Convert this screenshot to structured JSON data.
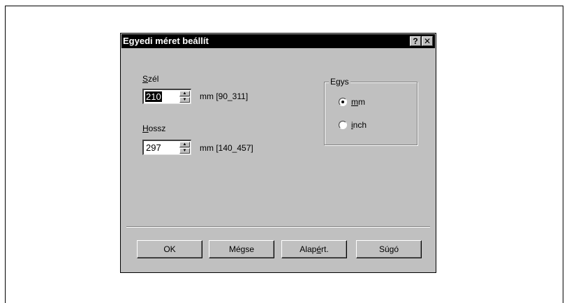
{
  "window": {
    "title": "Egyedi méret beállít",
    "help_label": "?",
    "close_label": "✕"
  },
  "width": {
    "label_accel": "S",
    "label_rest": "zél",
    "value": "210",
    "range": "mm [90_311]"
  },
  "length": {
    "label_accel": "H",
    "label_rest": "ossz",
    "value": "297",
    "range": "mm [140_457]"
  },
  "units": {
    "group_label": "Egys",
    "options": [
      {
        "accel": "m",
        "rest": "m",
        "selected": true
      },
      {
        "accel": "i",
        "rest": "nch",
        "selected": false
      }
    ]
  },
  "buttons": {
    "ok": "OK",
    "cancel": "Mégse",
    "defaults_pre": "Alap",
    "defaults_accel": "é",
    "defaults_post": "rt.",
    "help": "Súgó"
  },
  "colors": {
    "dialog_bg": "#c0c0c0",
    "titlebar_bg": "#000000",
    "titlebar_text": "#ffffff"
  }
}
